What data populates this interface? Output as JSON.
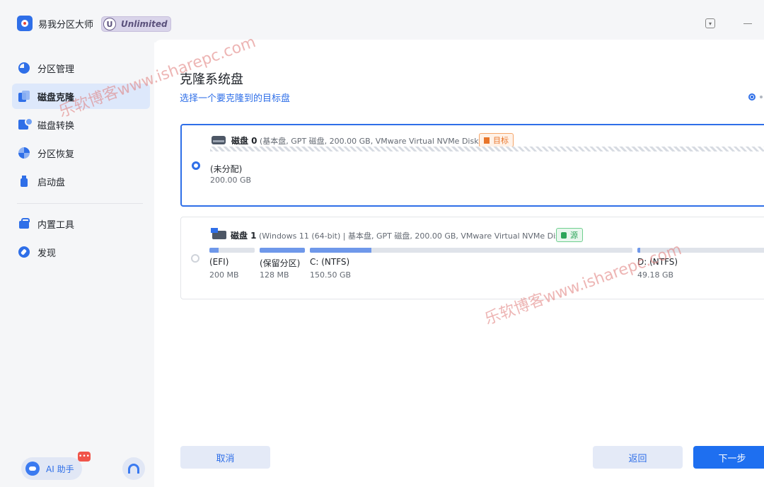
{
  "app": {
    "title": "易我分区大师",
    "badge_letter": "U",
    "badge_text": "Unlimited",
    "window_menu_glyph": "▾"
  },
  "sidebar": {
    "items": [
      {
        "label": "分区管理",
        "icon": "pie-chart-icon"
      },
      {
        "label": "磁盘克隆",
        "icon": "clone-icon",
        "active": true
      },
      {
        "label": "磁盘转换",
        "icon": "convert-icon"
      },
      {
        "label": "分区恢复",
        "icon": "recovery-icon"
      },
      {
        "label": "启动盘",
        "icon": "bootable-disk-icon"
      },
      {
        "label": "内置工具",
        "icon": "toolbox-icon"
      },
      {
        "label": "发现",
        "icon": "compass-icon"
      }
    ],
    "ai_label": "AI 助手",
    "ai_badge": "•••"
  },
  "main": {
    "title": "克隆系统盘",
    "subtitle": "选择一个要克隆到的目标盘",
    "disks": [
      {
        "name": "磁盘 0",
        "info": "(基本盘, GPT 磁盘, 200.00 GB, VMware Virtual NVMe Disk )",
        "tag": "目标",
        "selected": true,
        "partitions": [
          {
            "name": "(未分配)",
            "size": "200.00 GB"
          }
        ]
      },
      {
        "name": "磁盘 1",
        "info": "(Windows 11 (64-bit) | 基本盘, GPT 磁盘, 200.00 GB, VMware Virtual NVMe Disk )",
        "tag": "源",
        "selected": false,
        "partitions": [
          {
            "name": "(EFI)",
            "size": "200 MB",
            "used_fraction": 0.2
          },
          {
            "name": "(保留分区)",
            "size": "128 MB",
            "used_fraction": 1.0
          },
          {
            "name": "C: (NTFS)",
            "size": "150.50 GB",
            "used_fraction": 0.19
          },
          {
            "name": "D: (NTFS)",
            "size": "49.18 GB",
            "used_fraction": 0.02
          }
        ]
      }
    ]
  },
  "buttons": {
    "cancel": "取消",
    "back": "返回",
    "next": "下一步"
  },
  "watermark": "乐软博客www.isharepc.com",
  "colors": {
    "accent": "#2f6fe8",
    "target_tag": "#e8752a",
    "source_tag": "#2da55a",
    "bar_fill": "#6f98ea"
  }
}
